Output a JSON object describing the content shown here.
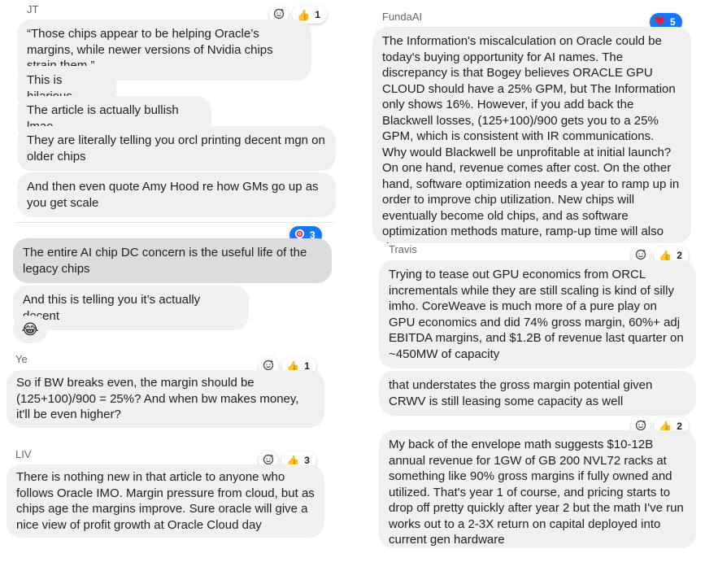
{
  "left": {
    "jt": {
      "name": "JT",
      "reaction_count": "1",
      "messages": [
        "“Those chips appear to be helping Oracle’s margins, while newer versions of Nvidia chips strain them.”",
        "This is hilarious",
        "The article is actually bullish lmao",
        "They are literally telling you orcl printing decent mgn on older chips",
        "And then even quote Amy Hood re how GMs go up as you get scale"
      ]
    },
    "unnamed": {
      "reaction_count": "3",
      "messages": [
        "The entire AI chip DC concern is the useful life of the legacy chips",
        "And this is telling you it’s actually decent"
      ],
      "emoji": "😂"
    },
    "ye": {
      "name": "Ye",
      "reaction_count": "1",
      "message": "So if BW breaks even, the margin should be (125+100)/900 = 25%? And when bw makes money, it'll be even higher?"
    },
    "liv": {
      "name": "LIV",
      "reaction_count": "3",
      "message": "There is nothing new in that article to anyone who follows Oracle IMO. Margin pressure from cloud, but as chips age the margins improve. Sure oracle will give a nice view of profit growth at Oracle Cloud day"
    }
  },
  "right": {
    "fundaai": {
      "name": "FundaAI",
      "reaction_count": "5",
      "message": "The Information's miscalculation on Oracle could be today's buying opportunity for AI names. The discrepancy is that Bogey believes ORACLE GPU CLOUD should have a 25% GPM, but The Information only shows 16%. However, if you add back the Blackwell losses, (125+100)/900 gets you to a 25% GPM, which is consistent with IR communications. Why would Blackwell be unprofitable at initial launch? On one hand, revenue comes after cost. On the other hand, software optimization needs a year to ramp up in order to improve chip utilization. New chips will eventually become old chips, and as software optimization methods mature, ramp-up time will also decrease."
    },
    "travis": {
      "name": "Travis",
      "reaction_count": "2",
      "messages": [
        "Trying to tease out GPU economics from ORCL incrementals while they are still scaling is kind of silly imho. CoreWeave is much more of a pure play on GPU economics and did 74% gross margin, 60%+ adj EBITDA margins, and $1.2B of revenue last quarter on ~450MW of capacity",
        "that understates the gross margin potential given CRWV is still leasing some capacity as well"
      ]
    },
    "last": {
      "reaction_count": "2",
      "message": "My back of the envelope math suggests $10-12B annual revenue for 1GW of GB 200 NVL72 racks at something like 90% gross margins if fully owned and utilized. That's year 1 of course, and pricing starts to drop off pretty quickly after year 2 but the math I've run works out to a 2-3X return on capital deployed into current gen hardware"
    }
  },
  "icons": {
    "add_reaction": "add-reaction-icon",
    "thumbs_up": "thumbs-up-icon",
    "heart": "heart-icon",
    "target": "target-icon",
    "laugh": "laughing-emoji-icon"
  },
  "colors": {
    "bubble": "#f0f0f0",
    "bubble_selected": "#dcdcdc",
    "reaction_blue": "#1877f2",
    "heart_red": "#e41e3f",
    "name_gray": "#65676b"
  }
}
